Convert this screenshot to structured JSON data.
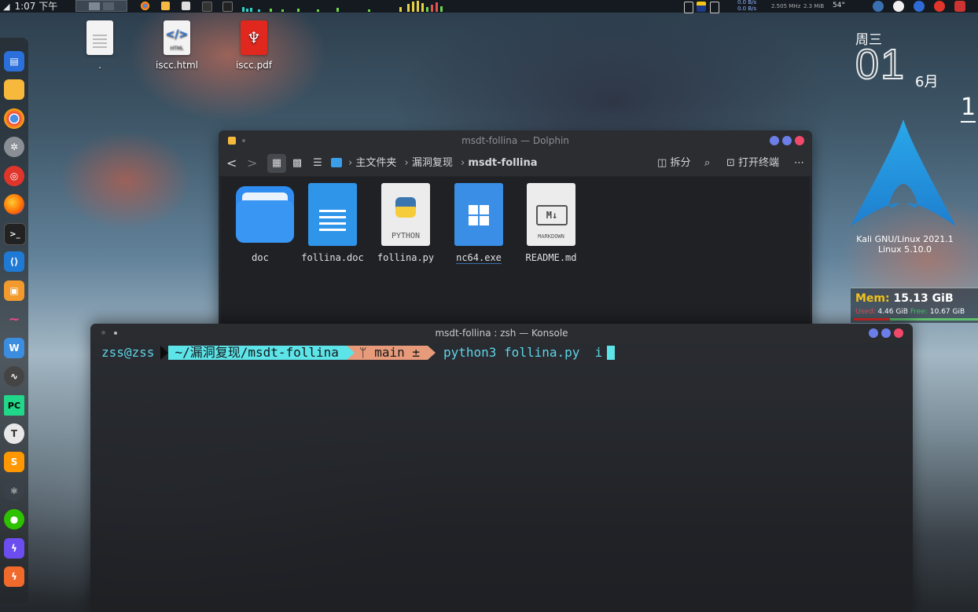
{
  "top_panel": {
    "time": "1:07 下午",
    "net_down": "0.0 B/s",
    "net_up": "0.0 B/s",
    "cpu_freq": "2.505 MHz",
    "swap": "2.3 MiB",
    "temp": "54°"
  },
  "desktop": {
    "icons": [
      {
        "label": "."
      },
      {
        "label": "iscc.html",
        "badge": "HTML"
      },
      {
        "label": "iscc.pdf"
      }
    ]
  },
  "clock_widget": {
    "weekday": "周三",
    "day": "01",
    "month": "6月",
    "edge_number": "1"
  },
  "system_info": {
    "distro": "Kali GNU/Linux 2021.1",
    "kernel": "Linux 5.10.0"
  },
  "memory": {
    "label": "Mem:",
    "total": "15.13 GiB",
    "used_label": "Used:",
    "used": "4.46 GiB",
    "free_label": "Free:",
    "free": "10.67 GiB",
    "used_fraction": 0.29
  },
  "dolphin": {
    "title": "msdt-follina — Dolphin",
    "breadcrumb": [
      "主文件夹",
      "漏洞复现",
      "msdt-follina"
    ],
    "split_label": "拆分",
    "terminal_label": "打开终端",
    "files": [
      {
        "name": "doc",
        "type": "folder"
      },
      {
        "name": "follina.doc",
        "type": "document"
      },
      {
        "name": "follina.py",
        "type": "python",
        "badge": "PYTHON"
      },
      {
        "name": "nc64.exe",
        "type": "exe"
      },
      {
        "name": "README.md",
        "type": "markdown",
        "badge": "MARKDOWN",
        "glyph": "M↓"
      }
    ]
  },
  "konsole": {
    "title": "msdt-follina : zsh — Konsole",
    "user_host": "zss@zss",
    "path": "~/漏洞复现/msdt-follina",
    "git_branch": "main ±",
    "command": "python3 follina.py  i"
  },
  "colors": {
    "cyan": "#5de4e8",
    "salmon": "#e79b7a",
    "text": "#5fd4e8"
  }
}
